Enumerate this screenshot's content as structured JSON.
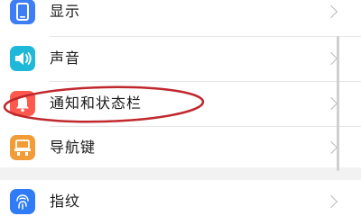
{
  "settings": {
    "items": [
      {
        "label": "显示",
        "icon": "display-icon",
        "color": "#3d7df6"
      },
      {
        "label": "声音",
        "icon": "sound-icon",
        "color": "#20b8d8"
      },
      {
        "label": "通知和状态栏",
        "icon": "notification-bell-icon",
        "color": "#ff5a4d"
      },
      {
        "label": "导航键",
        "icon": "navigation-keys-icon",
        "color": "#f29c38"
      },
      {
        "label": "指纹",
        "icon": "fingerprint-icon",
        "color": "#2f7cf6"
      }
    ]
  },
  "annotation": {
    "color": "#c0282e",
    "target": "通知和状态栏"
  }
}
